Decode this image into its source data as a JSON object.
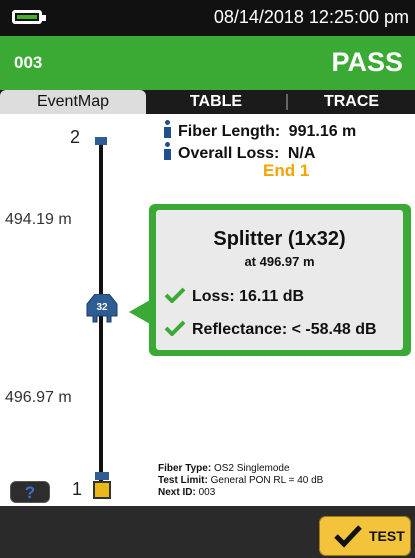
{
  "status": {
    "datetime": "08/14/2018 12:25:00 pm",
    "battery_icon": "battery-icon"
  },
  "header": {
    "id": "003",
    "result": "PASS",
    "color": "#3aaa35"
  },
  "tabs": [
    {
      "label": "EventMap",
      "active": true
    },
    {
      "label": "TABLE"
    },
    {
      "label": "TRACE"
    }
  ],
  "eventmap": {
    "events": {
      "top": "2",
      "bottom": "1"
    },
    "distances": {
      "upper": "494.19 m",
      "lower": "496.97 m"
    },
    "splitter_label": "32"
  },
  "summary": {
    "fiber_length_label": "Fiber Length:",
    "fiber_length_value": "991.16 m",
    "overall_loss_label": "Overall Loss:",
    "overall_loss_value": "N/A",
    "end_label": "End 1"
  },
  "popup": {
    "title": "Splitter (1x32)",
    "subtitle": "at 496.97 m",
    "loss": "Loss: 16.11 dB",
    "reflectance": "Reflectance: < -58.48 dB"
  },
  "fiber_info": {
    "fiber_type_label": "Fiber Type:",
    "fiber_type_value": "OS2 Singlemode",
    "test_limit_label": "Test Limit:",
    "test_limit_value": "General PON RL = 40 dB",
    "next_id_label": "Next ID:",
    "next_id_value": "003"
  },
  "help": {
    "label": "?"
  },
  "actions": {
    "test_label": "TEST"
  }
}
